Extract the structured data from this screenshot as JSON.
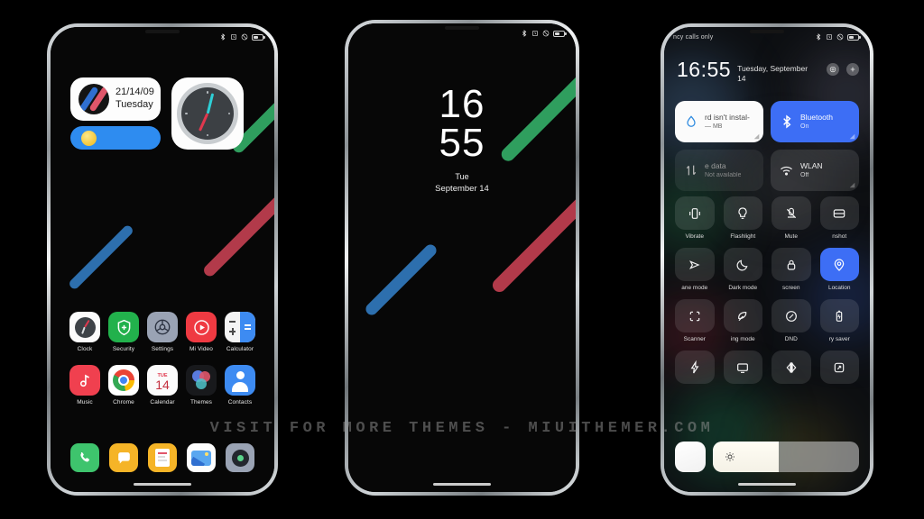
{
  "watermark": "VISIT  FOR  MORE  THEMES  -  MIUITHEMER.COM",
  "phone1": {
    "status": {
      "icons": [
        "bluetooth-icon",
        "alarm-icon",
        "dnd-icon",
        "battery-icon"
      ]
    },
    "date_widget": {
      "date": "21/14/09",
      "day": "Tuesday"
    },
    "apps_row1": [
      {
        "label": "Clock",
        "icon": "clock-icon"
      },
      {
        "label": "Security",
        "icon": "shield-icon"
      },
      {
        "label": "Settings",
        "icon": "gear-icon"
      },
      {
        "label": "Mi Video",
        "icon": "play-icon"
      },
      {
        "label": "Calculator",
        "icon": "calculator-icon"
      }
    ],
    "apps_row2": [
      {
        "label": "Music",
        "icon": "music-note-icon"
      },
      {
        "label": "Chrome",
        "icon": "chrome-icon"
      },
      {
        "label": "Calendar",
        "icon": "calendar-icon",
        "dow": "TUE",
        "day": "14"
      },
      {
        "label": "Themes",
        "icon": "themes-icon"
      },
      {
        "label": "Contacts",
        "icon": "contacts-icon"
      }
    ],
    "dock": [
      {
        "label": "Phone",
        "icon": "phone-icon"
      },
      {
        "label": "Messages",
        "icon": "message-icon"
      },
      {
        "label": "Notes",
        "icon": "notes-icon"
      },
      {
        "label": "Gallery",
        "icon": "gallery-icon"
      },
      {
        "label": "Camera",
        "icon": "camera-icon"
      }
    ]
  },
  "phone2": {
    "status": {
      "icons": [
        "bluetooth-icon",
        "alarm-icon",
        "dnd-icon",
        "battery-icon"
      ]
    },
    "lockscreen": {
      "hours": "16",
      "minutes": "55",
      "weekday": "Tue",
      "date": "September 14"
    }
  },
  "phone3": {
    "status": {
      "carrier": "ncy calls only",
      "icons": [
        "bluetooth-icon",
        "alarm-icon",
        "dnd-icon",
        "battery-icon"
      ]
    },
    "clock": {
      "time": "16:55",
      "date": "Tuesday, September 14"
    },
    "header_buttons": [
      {
        "name": "settings-button",
        "icon": "gear-icon"
      },
      {
        "name": "add-button",
        "icon": "plus-icon"
      }
    ],
    "big_tiles": [
      {
        "title": "rd isn't instal-",
        "sub": "— MB",
        "icon": "data-drop-icon",
        "style": "light"
      },
      {
        "title": "Bluetooth",
        "sub": "On",
        "icon": "bluetooth-icon",
        "style": "blue"
      },
      {
        "title": "e data",
        "sub": "Not available",
        "icon": "mobile-data-icon",
        "style": "dim"
      },
      {
        "title": "WLAN",
        "sub": "Off",
        "icon": "wifi-icon",
        "style": "dark"
      }
    ],
    "toggles": [
      {
        "label": "Vibrate",
        "icon": "vibrate-icon",
        "on": false
      },
      {
        "label": "Flashlight",
        "icon": "flashlight-icon",
        "on": false
      },
      {
        "label": "Mute",
        "icon": "mute-icon",
        "on": false
      },
      {
        "label": "nshot",
        "icon": "screenshot-icon",
        "on": false
      },
      {
        "label": "ane mode",
        "icon": "airplane-icon",
        "on": false
      },
      {
        "label": "Dark mode",
        "icon": "moon-icon",
        "on": false
      },
      {
        "label": "screen",
        "icon": "lock-icon",
        "on": false
      },
      {
        "label": "Location",
        "icon": "location-icon",
        "on": true
      },
      {
        "label": "Scanner",
        "icon": "scanner-icon",
        "on": false
      },
      {
        "label": "ing mode",
        "icon": "reading-mode-icon",
        "on": false
      },
      {
        "label": "DND",
        "icon": "dnd-icon",
        "on": false
      },
      {
        "label": "ry saver",
        "icon": "battery-saver-icon",
        "on": false
      },
      {
        "label": "",
        "icon": "bolt-icon",
        "on": false
      },
      {
        "label": "",
        "icon": "cast-icon",
        "on": false
      },
      {
        "label": "",
        "icon": "contrast-icon",
        "on": false
      },
      {
        "label": "",
        "icon": "rotate-icon",
        "on": false
      }
    ],
    "brightness": {
      "value": 45,
      "icon": "sun-icon"
    }
  },
  "colors": {
    "stripe_blue": "#2d6fae",
    "stripe_red": "#b23a4a",
    "stripe_green": "#2f9e5e",
    "accent_blue": "#3d6ef5",
    "widget_blue": "#2e8cf0"
  }
}
